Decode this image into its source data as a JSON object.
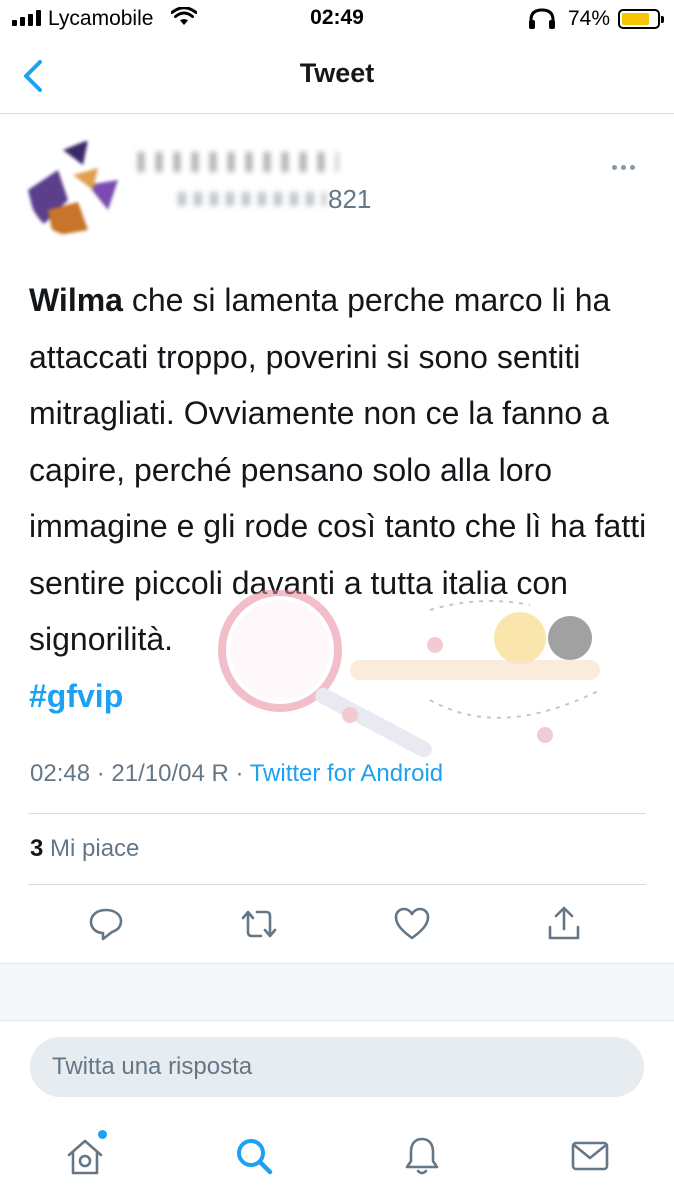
{
  "status_bar": {
    "carrier": "Lycamobile",
    "time": "02:49",
    "battery_percent": "74%",
    "battery_level": 0.74,
    "icons": [
      "signal-icon",
      "wifi-icon",
      "headphones-icon",
      "battery-icon"
    ]
  },
  "header": {
    "title": "Tweet",
    "back_icon": "chevron-left-icon"
  },
  "author": {
    "handle_partial": "821",
    "more_icon": "more-horizontal-icon"
  },
  "tweet": {
    "lead_word": "Wilma",
    "body": " che si lamenta perche marco li ha attaccati troppo, poverini si sono sentiti mitragliati. Ovviamente non ce la fanno a capire, perché pensano solo alla loro immagine e gli rode così tanto che lì ha fatti sentire piccoli davanti a tutta italia con signorilità.",
    "hashtag": "#gfvip",
    "timestamp": "02:48 · 21/10/04 R · ",
    "source": "Twitter for Android"
  },
  "stats": {
    "likes_count": "3",
    "likes_label": " Mi piace"
  },
  "actions": [
    "reply-icon",
    "retweet-icon",
    "like-icon",
    "share-icon"
  ],
  "reply": {
    "placeholder": "Twitta una risposta"
  },
  "tabbar": {
    "items": [
      "home-icon",
      "search-icon",
      "notifications-icon",
      "messages-icon"
    ],
    "accent_color": "#1da1f2"
  },
  "colors": {
    "accent": "#1da1f2",
    "text": "#14171a",
    "secondary": "#657786"
  }
}
